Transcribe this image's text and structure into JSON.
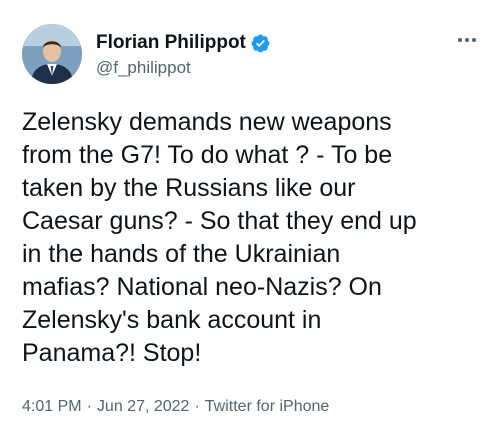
{
  "author": {
    "display_name": "Florian Philippot",
    "handle": "@f_philippot",
    "verified_color": "#1d9bf0"
  },
  "icons": {
    "verified": "verified-badge-icon",
    "more": "more-options-icon"
  },
  "tweet": {
    "text": "Zelensky demands new weapons\nfrom the G7! To do what ? - To be\ntaken by the Russians like our\nCaesar guns? - So that they end up\nin the hands of the Ukrainian\nmafias? National neo-Nazis? On\nZelensky's bank account in\nPanama?! Stop!",
    "time": "4:01 PM",
    "date": "Jun 27, 2022",
    "source": "Twitter for iPhone",
    "separator": "·"
  }
}
